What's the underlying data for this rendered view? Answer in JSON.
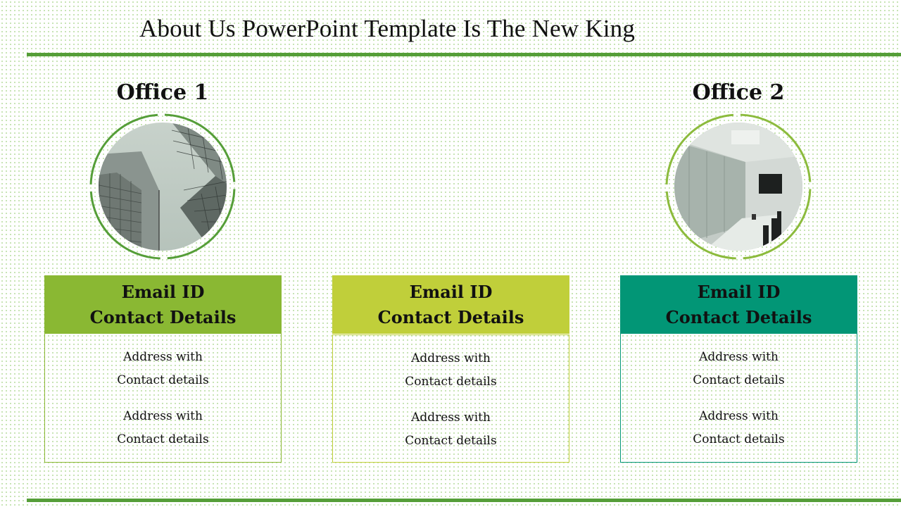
{
  "slide": {
    "title": "About Us PowerPoint Template Is The New King",
    "accent_color": "#559e38"
  },
  "offices": [
    {
      "label": "Office 1",
      "photo": "office-building-skyscrapers-image",
      "ring_color": "#559e38"
    },
    {
      "label": "Office 2",
      "photo": "conference-room-image",
      "ring_color": "#8cbb3c"
    }
  ],
  "cards": [
    {
      "header_line1": "Email ID",
      "header_line2": "Contact Details",
      "header_color": "#8ab833",
      "border_color": "#8ab833",
      "entries": [
        {
          "line1": "Address with",
          "line2": "Contact details"
        },
        {
          "line1": "Address with",
          "line2": "Contact details"
        }
      ]
    },
    {
      "header_line1": "Email ID",
      "header_line2": "Contact Details",
      "header_color": "#c0cf3a",
      "border_color": "#c0cf3a",
      "entries": [
        {
          "line1": "Address with",
          "line2": "Contact details"
        },
        {
          "line1": "Address with",
          "line2": "Contact details"
        }
      ]
    },
    {
      "header_line1": "Email ID",
      "header_line2": "Contact Details",
      "header_color": "#029676",
      "border_color": "#029676",
      "entries": [
        {
          "line1": "Address with",
          "line2": "Contact details"
        },
        {
          "line1": "Address with",
          "line2": "Contact details"
        }
      ]
    }
  ]
}
